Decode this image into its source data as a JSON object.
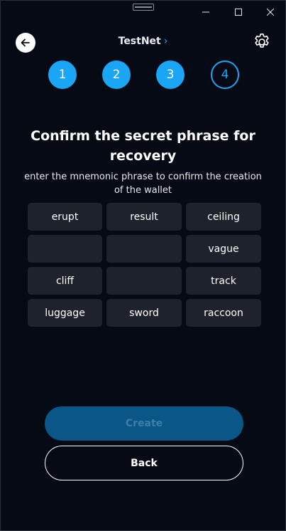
{
  "header": {
    "network_name": "TestNet",
    "network_chevron": "›"
  },
  "steps": [
    {
      "label": "1",
      "state": "done"
    },
    {
      "label": "2",
      "state": "done"
    },
    {
      "label": "3",
      "state": "done"
    },
    {
      "label": "4",
      "state": "current"
    }
  ],
  "main": {
    "title": "Confirm the secret phrase for recovery",
    "subtitle": "enter the mnemonic phrase to confirm the creation of the wallet"
  },
  "mnemonic": {
    "words": [
      "erupt",
      "result",
      "ceiling",
      "",
      "",
      "vague",
      "cliff",
      "",
      "track",
      "luggage",
      "sword",
      "raccoon"
    ]
  },
  "buttons": {
    "create_label": "Create",
    "back_label": "Back"
  },
  "colors": {
    "accent": "#1aa6f5",
    "background": "#050a14",
    "tile": "#1e222c",
    "create_disabled_bg": "#0a5686"
  },
  "icons": {
    "back": "arrow-left-icon",
    "settings": "gear-icon",
    "minimize": "minimize-icon",
    "maximize": "maximize-icon",
    "close": "close-icon"
  }
}
